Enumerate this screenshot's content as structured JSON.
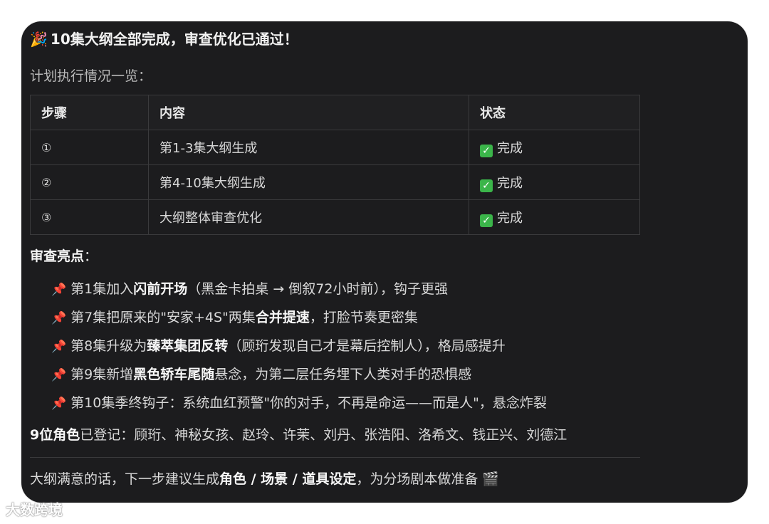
{
  "message": {
    "headline_emoji": "🎉",
    "headline": "10集大纲全部完成，审查优化已通过！",
    "subtitle": "计划执行情况一览：",
    "table": {
      "headers": [
        "步骤",
        "内容",
        "状态"
      ],
      "rows": [
        {
          "step": "①",
          "content": "第1-3集大纲生成",
          "status_icon": "check-mark-icon",
          "status": "完成"
        },
        {
          "step": "②",
          "content": "第4-10集大纲生成",
          "status_icon": "check-mark-icon",
          "status": "完成"
        },
        {
          "step": "③",
          "content": "大纲整体审查优化",
          "status_icon": "check-mark-icon",
          "status": "完成"
        }
      ]
    },
    "review_title": "审查亮点",
    "review_title_suffix": "：",
    "highlights": [
      {
        "icon": "pushpin-icon",
        "pre": "第1集加入",
        "bold": "闪前开场",
        "post": "（黑金卡拍桌 → 倒叙72小时前），钩子更强"
      },
      {
        "icon": "pushpin-icon",
        "pre": "第7集把原来的\"安家+4S\"两集",
        "bold": "合并提速",
        "post": "，打脸节奏更密集"
      },
      {
        "icon": "pushpin-icon",
        "pre": "第8集升级为",
        "bold": "臻萃集团反转",
        "post": "（顾珩发现自己才是幕后控制人），格局感提升"
      },
      {
        "icon": "pushpin-icon",
        "pre": "第9集新增",
        "bold": "黑色轿车尾随",
        "post": "悬念，为第二层任务埋下人类对手的恐惧感"
      },
      {
        "icon": "pushpin-icon",
        "pre": "第10集季终钩子：系统血红预警\"你的对手，不再是命运——而是人\"，悬念炸裂",
        "bold": "",
        "post": ""
      }
    ],
    "roles": {
      "bold": "9位角色",
      "text": "已登记：顾珩、神秘女孩、赵玲、许茉、刘丹、张浩阳、洛希文、钱正兴、刘德江"
    },
    "next_step": {
      "pre": "大纲满意的话，下一步建议生成",
      "bold": "角色 / 场景 / 道具设定",
      "post": "，为分场剧本做准备",
      "emoji": "🎬"
    }
  },
  "watermark": "大数跨境",
  "colors": {
    "card_bg": "#1c1c1e",
    "border": "#3a3a3c",
    "check_green": "#3bb54a",
    "pin_red": "#e5484d"
  }
}
